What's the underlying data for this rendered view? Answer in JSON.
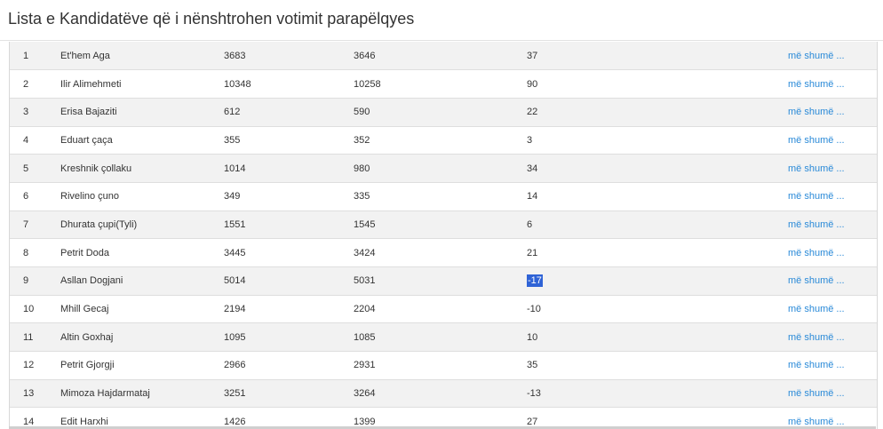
{
  "header": {
    "title": "Lista e Kandidatëve që i nënshtrohen votimit parapëlqyes"
  },
  "table": {
    "rows": [
      {
        "num": "1",
        "name": "Et'hem Aga",
        "v1": "3683",
        "v2": "3646",
        "diff": "37",
        "more": "më shumë ..."
      },
      {
        "num": "2",
        "name": "Ilir Alimehmeti",
        "v1": "10348",
        "v2": "10258",
        "diff": "90",
        "more": "më shumë ..."
      },
      {
        "num": "3",
        "name": "Erisa Bajaziti",
        "v1": "612",
        "v2": "590",
        "diff": "22",
        "more": "më shumë ..."
      },
      {
        "num": "4",
        "name": "Eduart çaça",
        "v1": "355",
        "v2": "352",
        "diff": "3",
        "more": "më shumë ..."
      },
      {
        "num": "5",
        "name": "Kreshnik çollaku",
        "v1": "1014",
        "v2": "980",
        "diff": "34",
        "more": "më shumë ..."
      },
      {
        "num": "6",
        "name": "Rivelino çuno",
        "v1": "349",
        "v2": "335",
        "diff": "14",
        "more": "më shumë ..."
      },
      {
        "num": "7",
        "name": "Dhurata çupi(Tyli)",
        "v1": "1551",
        "v2": "1545",
        "diff": "6",
        "more": "më shumë ..."
      },
      {
        "num": "8",
        "name": "Petrit Doda",
        "v1": "3445",
        "v2": "3424",
        "diff": "21",
        "more": "më shumë ..."
      },
      {
        "num": "9",
        "name": "Asllan Dogjani",
        "v1": "5014",
        "v2": "5031",
        "diff": "-17",
        "more": "më shumë ..."
      },
      {
        "num": "10",
        "name": "Mhill Gecaj",
        "v1": "2194",
        "v2": "2204",
        "diff": "-10",
        "more": "më shumë ..."
      },
      {
        "num": "11",
        "name": "Altin Goxhaj",
        "v1": "1095",
        "v2": "1085",
        "diff": "10",
        "more": "më shumë ..."
      },
      {
        "num": "12",
        "name": "Petrit Gjorgji",
        "v1": "2966",
        "v2": "2931",
        "diff": "35",
        "more": "më shumë ..."
      },
      {
        "num": "13",
        "name": "Mimoza Hajdarmataj",
        "v1": "3251",
        "v2": "3264",
        "diff": "-13",
        "more": "më shumë ..."
      },
      {
        "num": "14",
        "name": "Edit Harxhi",
        "v1": "1426",
        "v2": "1399",
        "diff": "27",
        "more": "më shumë ..."
      }
    ]
  },
  "colors": {
    "link": "#2a8ad8",
    "row_alt": "#f2f2f2",
    "selection": "#2f63d6"
  }
}
